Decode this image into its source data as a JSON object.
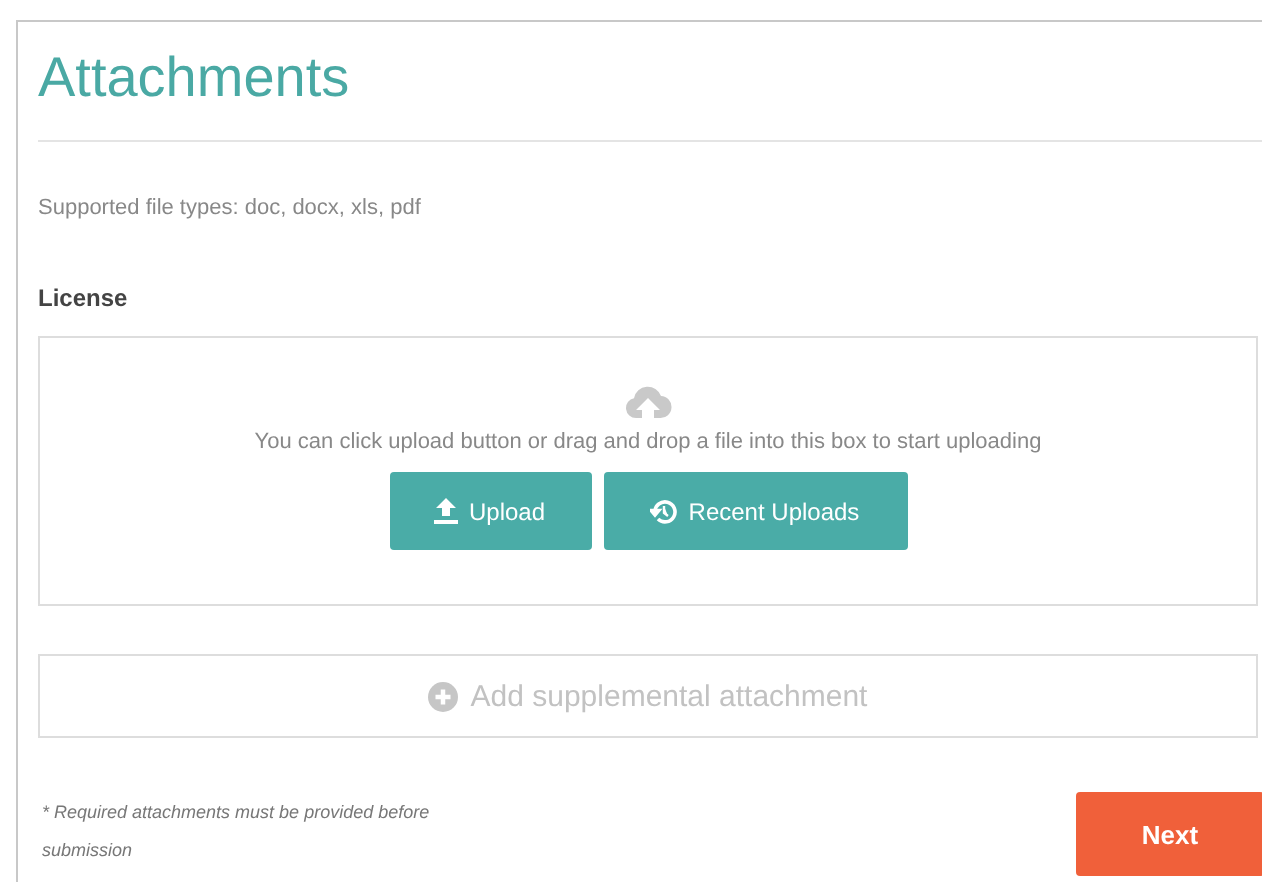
{
  "title": "Attachments",
  "supported_types": "Supported file types: doc, docx, xls, pdf",
  "sections": [
    {
      "label": "License",
      "dropzone_text": "You can click upload button or drag and drop a file into this box to start uploading",
      "buttons": [
        {
          "kind": "upload",
          "label": "Upload"
        },
        {
          "kind": "recent",
          "label": "Recent Uploads"
        }
      ]
    }
  ],
  "add_button": "Add supplemental attachment",
  "footnote": "* Required attachments must be provided before submission",
  "next_button": "Next"
}
